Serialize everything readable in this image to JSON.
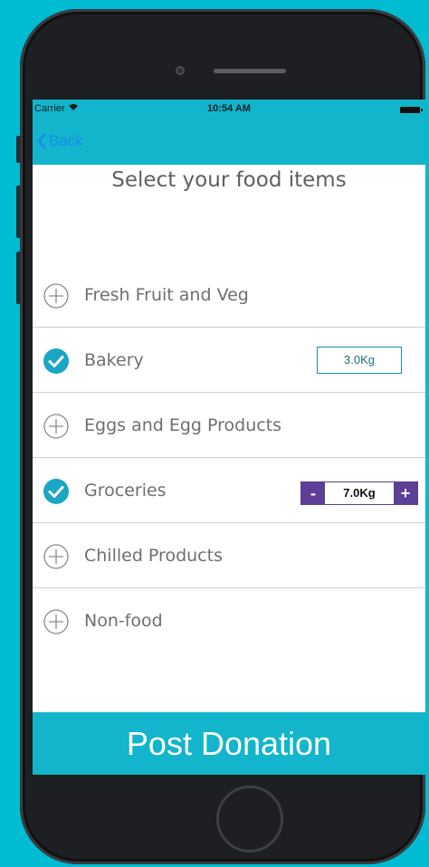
{
  "status_bar": {
    "carrier": "Carrier",
    "time": "10:54 AM"
  },
  "nav": {
    "back_label": "Back"
  },
  "title": "Select your food items",
  "items": [
    {
      "label": "Fresh Fruit and Veg",
      "selected": false
    },
    {
      "label": "Bakery",
      "selected": true,
      "quantity": "3.0Kg"
    },
    {
      "label": "Eggs and Egg Products",
      "selected": false
    },
    {
      "label": "Groceries",
      "selected": true,
      "quantity": "7.0Kg",
      "stepper": {
        "minus": "-",
        "plus": "+"
      }
    },
    {
      "label": "Chilled Products",
      "selected": false
    },
    {
      "label": "Non-food",
      "selected": false
    }
  ],
  "post_button": "Post Donation",
  "colors": {
    "background": "#00bcd2",
    "bar": "#12b5cb",
    "check": "#1aa6c4",
    "stepper": "#5d3f97",
    "back_link": "#1a8cf0"
  },
  "icons": {
    "unselected": "plus-circle-icon",
    "selected": "check-circle-icon"
  }
}
